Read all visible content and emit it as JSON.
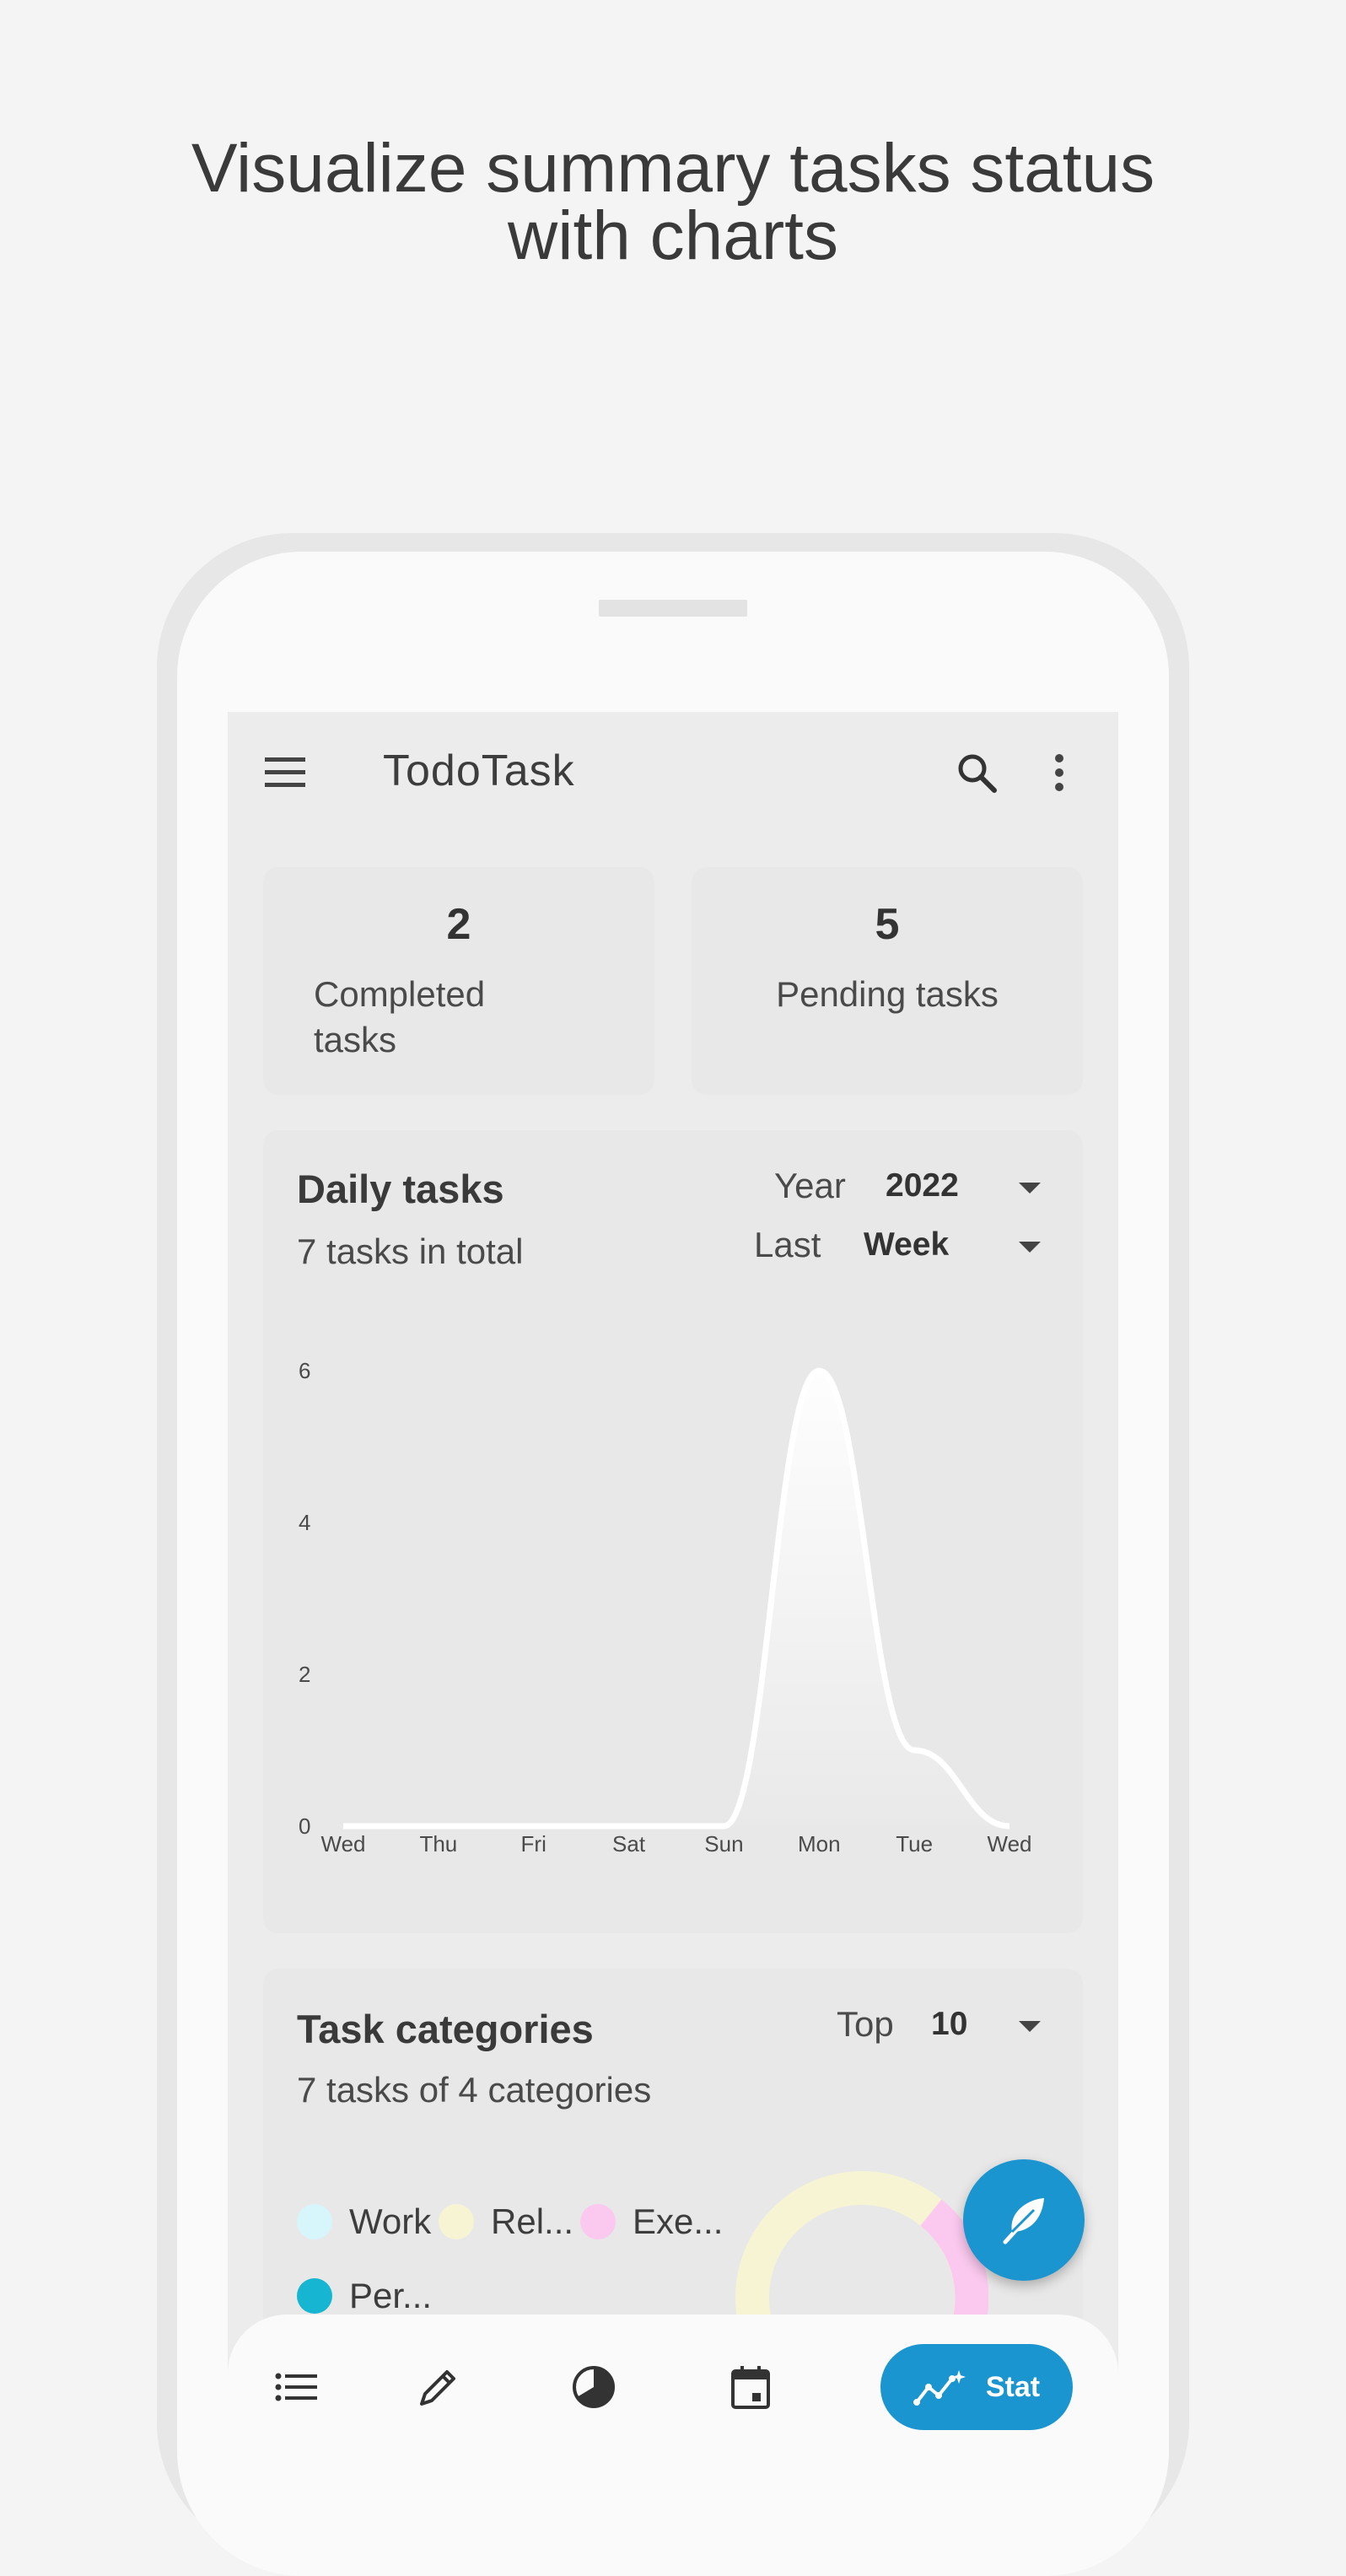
{
  "headline": {
    "line1": "Visualize summary tasks status",
    "line2": "with charts"
  },
  "app": {
    "title": "TodoTask",
    "icons": {
      "menu": "menu-icon",
      "search": "search-icon",
      "more": "more-vert-icon"
    }
  },
  "summary": {
    "completed": {
      "count": "2",
      "label": "Completed tasks"
    },
    "pending": {
      "count": "5",
      "label": "Pending tasks"
    }
  },
  "daily": {
    "title": "Daily tasks",
    "subtitle": "7 tasks in total",
    "year_label": "Year",
    "year_value": "2022",
    "last_label": "Last",
    "last_value": "Week"
  },
  "chart_data": {
    "type": "area",
    "title": "",
    "xlabel": "",
    "ylabel": "",
    "categories": [
      "Wed",
      "Thu",
      "Fri",
      "Sat",
      "Sun",
      "Mon",
      "Tue",
      "Wed"
    ],
    "values": [
      0,
      0,
      0,
      0,
      0,
      6,
      1,
      0
    ],
    "yticks": [
      0,
      2,
      4,
      6
    ],
    "ylim": [
      0,
      6
    ],
    "grid": false,
    "line_color": "#ffffff"
  },
  "categories": {
    "title": "Task categories",
    "subtitle": "7 tasks of 4 categories",
    "top_label": "Top",
    "top_value": "10",
    "legend": [
      {
        "label": "Work",
        "color": "#d6f6fb"
      },
      {
        "label": "Rel...",
        "color": "#f7f4d4"
      },
      {
        "label": "Exe...",
        "color": "#fbc9ef"
      },
      {
        "label": "Per...",
        "color": "#16b6d2"
      }
    ],
    "donut_colors": [
      "#f7f4d4",
      "#fbc9ef"
    ]
  },
  "nav": {
    "items": [
      "list-icon",
      "edit-icon",
      "chart-pie-icon",
      "calendar-icon"
    ],
    "active_label": "Stat",
    "accent": "#1a95cf"
  }
}
